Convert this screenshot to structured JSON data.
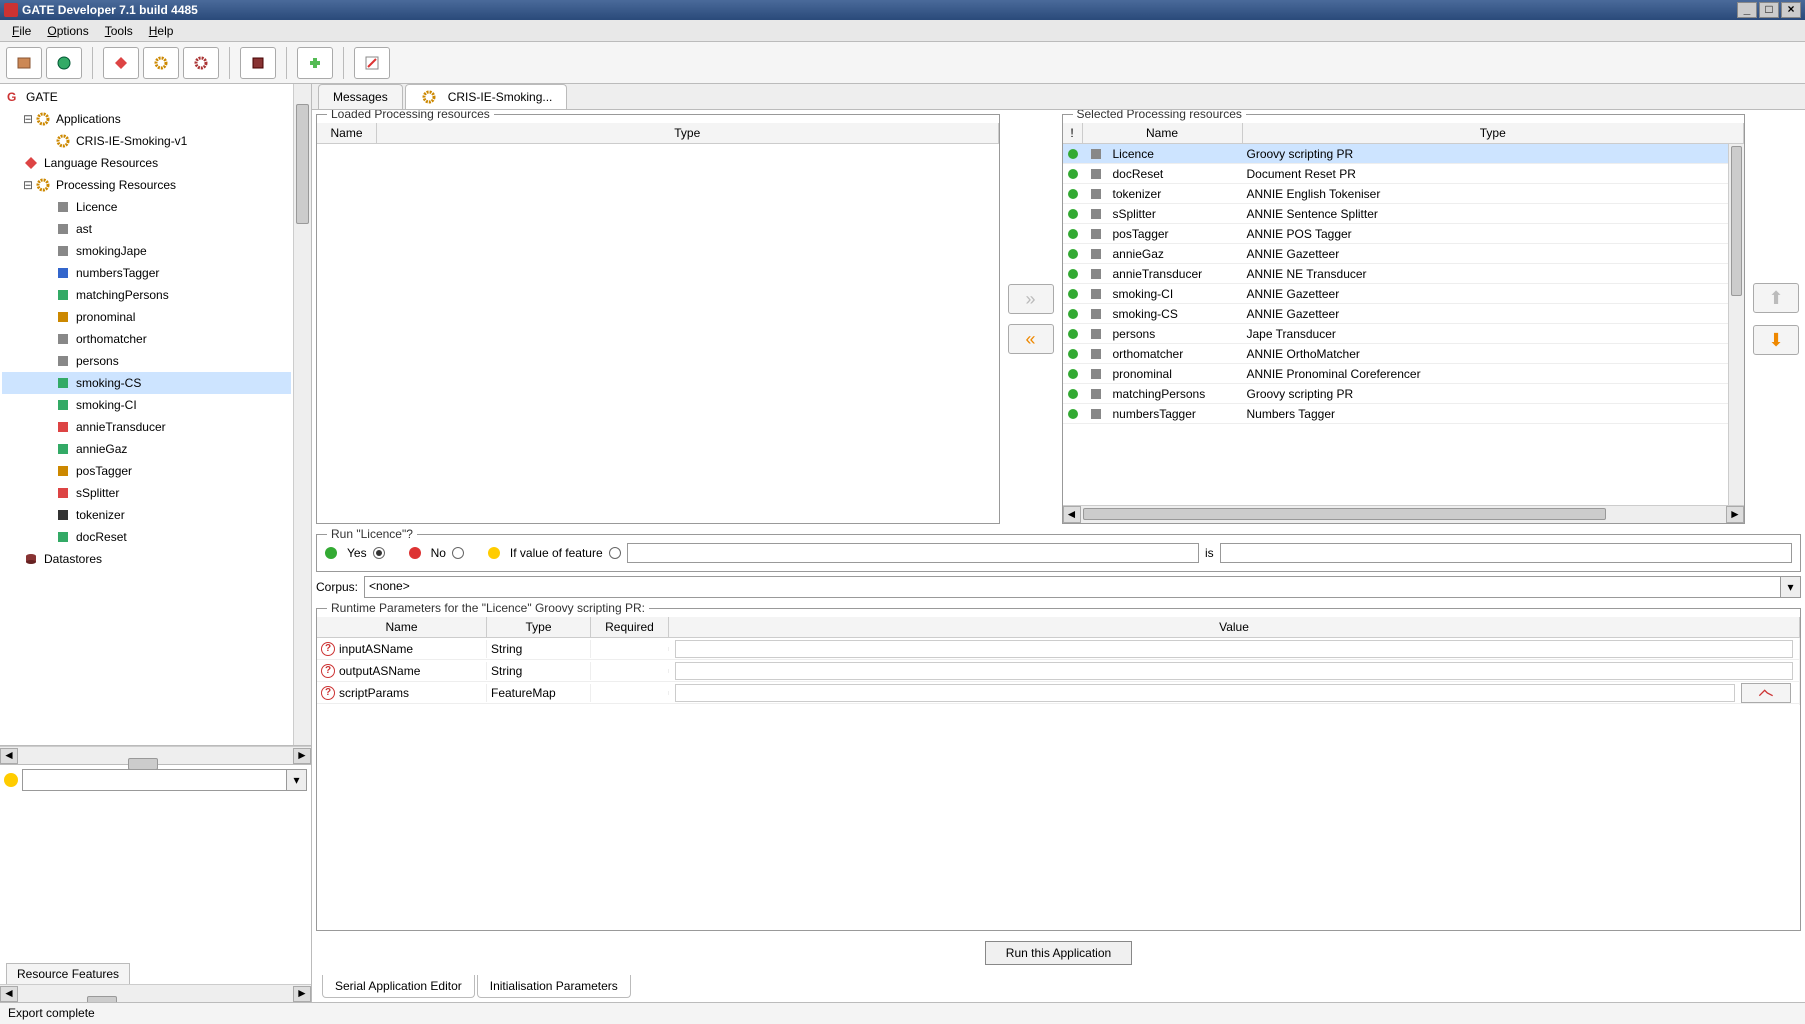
{
  "title": "GATE Developer 7.1 build 4485",
  "menubar": [
    "File",
    "Options",
    "Tools",
    "Help"
  ],
  "tabs": {
    "messages": "Messages",
    "app": "CRIS-IE-Smoking..."
  },
  "tree": {
    "root": "GATE",
    "apps": "Applications",
    "app_item": "CRIS-IE-Smoking-v1",
    "lang": "Language Resources",
    "proc": "Processing Resources",
    "proc_items": [
      "Licence",
      "ast",
      "smokingJape",
      "numbersTagger",
      "matchingPersons",
      "pronominal",
      "orthomatcher",
      "persons",
      "smoking-CS",
      "smoking-CI",
      "annieTransducer",
      "annieGaz",
      "posTagger",
      "sSplitter",
      "tokenizer",
      "docReset"
    ],
    "data": "Datastores"
  },
  "features_tab": "Resource Features",
  "loaded_label": "Loaded Processing resources",
  "loaded_cols": {
    "name": "Name",
    "type": "Type"
  },
  "selected_label": "Selected Processing resources",
  "selected_cols": {
    "bang": "!",
    "name": "Name",
    "type": "Type"
  },
  "selected_rows": [
    {
      "name": "Licence",
      "type": "Groovy scripting PR",
      "sel": true
    },
    {
      "name": "docReset",
      "type": "Document Reset PR"
    },
    {
      "name": "tokenizer",
      "type": "ANNIE English Tokeniser"
    },
    {
      "name": "sSplitter",
      "type": "ANNIE Sentence Splitter"
    },
    {
      "name": "posTagger",
      "type": "ANNIE POS Tagger"
    },
    {
      "name": "annieGaz",
      "type": "ANNIE Gazetteer"
    },
    {
      "name": "annieTransducer",
      "type": "ANNIE NE Transducer"
    },
    {
      "name": "smoking-CI",
      "type": "ANNIE Gazetteer"
    },
    {
      "name": "smoking-CS",
      "type": "ANNIE Gazetteer"
    },
    {
      "name": "persons",
      "type": "Jape Transducer"
    },
    {
      "name": "orthomatcher",
      "type": "ANNIE OrthoMatcher"
    },
    {
      "name": "pronominal",
      "type": "ANNIE Pronominal Coreferencer"
    },
    {
      "name": "matchingPersons",
      "type": "Groovy scripting PR"
    },
    {
      "name": "numbersTagger",
      "type": "Numbers Tagger"
    }
  ],
  "run_label": "Run \"Licence\"?",
  "yes": "Yes",
  "no": "No",
  "ifval": "If value of feature",
  "is": "is",
  "corpus_label": "Corpus:",
  "corpus_value": "<none>",
  "runtime_label": "Runtime Parameters for the \"Licence\" Groovy scripting PR:",
  "rt_cols": {
    "name": "Name",
    "type": "Type",
    "req": "Required",
    "val": "Value"
  },
  "rt_rows": [
    {
      "name": "inputASName",
      "type": "String"
    },
    {
      "name": "outputASName",
      "type": "String"
    },
    {
      "name": "scriptParams",
      "type": "FeatureMap",
      "fm": true
    }
  ],
  "run_app": "Run this Application",
  "bottom_tabs": {
    "serial": "Serial Application Editor",
    "init": "Initialisation Parameters"
  },
  "status": "Export complete"
}
